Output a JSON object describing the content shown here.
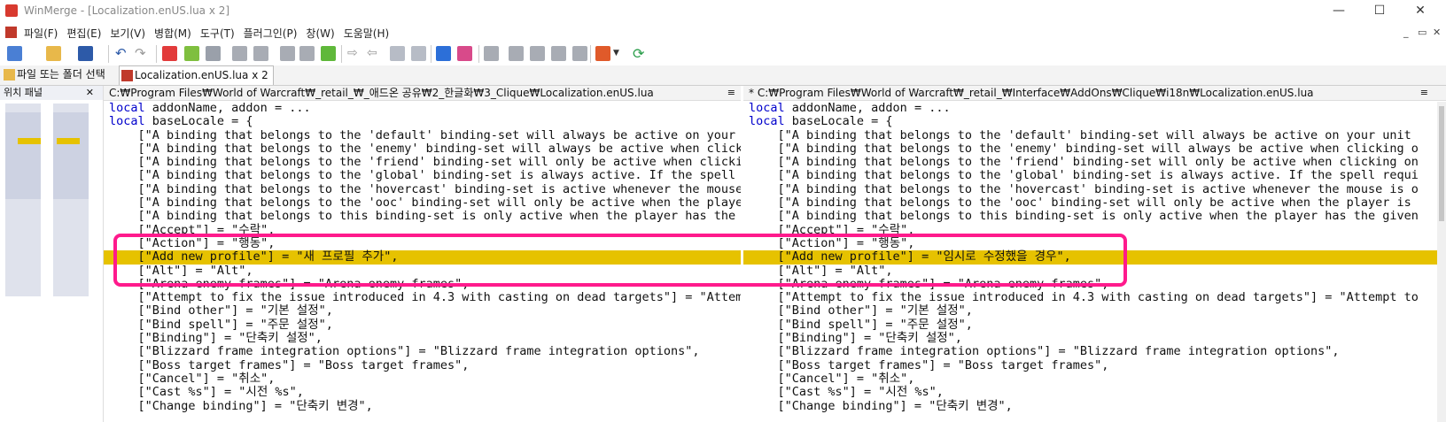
{
  "window": {
    "title": "WinMerge - [Localization.enUS.lua x 2]",
    "controls": [
      "—",
      "☐",
      "✕"
    ]
  },
  "menu": [
    "파일(F)",
    "편집(E)",
    "보기(V)",
    "병합(M)",
    "도구(T)",
    "플러그인(P)",
    "창(W)",
    "도움말(H)"
  ],
  "mdi_controls": [
    "_",
    "▭",
    "✕"
  ],
  "tabs": [
    {
      "label": "파일 또는 폴더 선택",
      "active": false
    },
    {
      "label": "Localization.enUS.lua x 2",
      "active": true
    }
  ],
  "location_pane": {
    "title": "위치 패널",
    "close": "✕"
  },
  "left_pane": {
    "path": "C:₩Program Files₩World of Warcraft₩_retail_₩_애드온 공유₩2_한글화₩3_Clique₩Localization.enUS.lua",
    "menu_glyph": "≡"
  },
  "right_pane": {
    "path": "* C:₩Program Files₩World of Warcraft₩_retail_₩Interface₩AddOns₩Clique₩i18n₩Localization.enUS.lua",
    "menu_glyph": "≡"
  },
  "left_lines": [
    {
      "kw": "local",
      "rest": " addonName, addon = ..."
    },
    {
      "kw": "local",
      "rest": " baseLocale = {"
    },
    {
      "kw": "",
      "rest": "    [\"A binding that belongs to the 'default' binding-set will always be active on your unit"
    },
    {
      "kw": "",
      "rest": "    [\"A binding that belongs to the 'enemy' binding-set will always be active when clicking o"
    },
    {
      "kw": "",
      "rest": "    [\"A binding that belongs to the 'friend' binding-set will only be active when clicking on"
    },
    {
      "kw": "",
      "rest": "    [\"A binding that belongs to the 'global' binding-set is always active. If the spell requi"
    },
    {
      "kw": "",
      "rest": "    [\"A binding that belongs to the 'hovercast' binding-set is active whenever the mouse is o"
    },
    {
      "kw": "",
      "rest": "    [\"A binding that belongs to the 'ooc' binding-set will only be active when the player is"
    },
    {
      "kw": "",
      "rest": "    [\"A binding that belongs to this binding-set is only active when the player has the given"
    },
    {
      "kw": "",
      "rest": "    [\"Accept\"] = \"수락\","
    },
    {
      "kw": "",
      "rest": "    [\"Action\"] = \"행동\","
    },
    {
      "kw": "",
      "rest": "    [\"Add new profile\"] = \"새 프로필 추가\",",
      "hl": true
    },
    {
      "kw": "",
      "rest": "    [\"Alt\"] = \"Alt\","
    },
    {
      "kw": "",
      "rest": "    [\"Arena enemy frames\"] = \"Arena enemy frames\","
    },
    {
      "kw": "",
      "rest": "    [\"Attempt to fix the issue introduced in 4.3 with casting on dead targets\"] = \"Attempt to"
    },
    {
      "kw": "",
      "rest": "    [\"Bind other\"] = \"기본 설정\","
    },
    {
      "kw": "",
      "rest": "    [\"Bind spell\"] = \"주문 설정\","
    },
    {
      "kw": "",
      "rest": "    [\"Binding\"] = \"단축키 설정\","
    },
    {
      "kw": "",
      "rest": "    [\"Blizzard frame integration options\"] = \"Blizzard frame integration options\","
    },
    {
      "kw": "",
      "rest": "    [\"Boss target frames\"] = \"Boss target frames\","
    },
    {
      "kw": "",
      "rest": "    [\"Cancel\"] = \"취소\","
    },
    {
      "kw": "",
      "rest": "    [\"Cast %s\"] = \"시전 %s\","
    },
    {
      "kw": "",
      "rest": "    [\"Change binding\"] = \"단축키 변경\","
    }
  ],
  "right_lines": [
    {
      "kw": "local",
      "rest": " addonName, addon = ..."
    },
    {
      "kw": "local",
      "rest": " baseLocale = {"
    },
    {
      "kw": "",
      "rest": "    [\"A binding that belongs to the 'default' binding-set will always be active on your unit"
    },
    {
      "kw": "",
      "rest": "    [\"A binding that belongs to the 'enemy' binding-set will always be active when clicking o"
    },
    {
      "kw": "",
      "rest": "    [\"A binding that belongs to the 'friend' binding-set will only be active when clicking on"
    },
    {
      "kw": "",
      "rest": "    [\"A binding that belongs to the 'global' binding-set is always active. If the spell requi"
    },
    {
      "kw": "",
      "rest": "    [\"A binding that belongs to the 'hovercast' binding-set is active whenever the mouse is o"
    },
    {
      "kw": "",
      "rest": "    [\"A binding that belongs to the 'ooc' binding-set will only be active when the player is"
    },
    {
      "kw": "",
      "rest": "    [\"A binding that belongs to this binding-set is only active when the player has the given"
    },
    {
      "kw": "",
      "rest": "    [\"Accept\"] = \"수락\","
    },
    {
      "kw": "",
      "rest": "    [\"Action\"] = \"행동\","
    },
    {
      "kw": "",
      "rest": "    [\"Add new profile\"] = \"임시로 수정했을 경우\",",
      "hl": true
    },
    {
      "kw": "",
      "rest": "    [\"Alt\"] = \"Alt\","
    },
    {
      "kw": "",
      "rest": "    [\"Arena enemy frames\"] = \"Arena enemy frames\","
    },
    {
      "kw": "",
      "rest": "    [\"Attempt to fix the issue introduced in 4.3 with casting on dead targets\"] = \"Attempt to"
    },
    {
      "kw": "",
      "rest": "    [\"Bind other\"] = \"기본 설정\","
    },
    {
      "kw": "",
      "rest": "    [\"Bind spell\"] = \"주문 설정\","
    },
    {
      "kw": "",
      "rest": "    [\"Binding\"] = \"단축키 설정\","
    },
    {
      "kw": "",
      "rest": "    [\"Blizzard frame integration options\"] = \"Blizzard frame integration options\","
    },
    {
      "kw": "",
      "rest": "    [\"Boss target frames\"] = \"Boss target frames\","
    },
    {
      "kw": "",
      "rest": "    [\"Cancel\"] = \"취소\","
    },
    {
      "kw": "",
      "rest": "    [\"Cast %s\"] = \"시전 %s\","
    },
    {
      "kw": "",
      "rest": "    [\"Change binding\"] = \"단축키 변경\","
    }
  ],
  "toolbar_icons": [
    "new-icon",
    "open-icon",
    "save-icon",
    "undo-icon",
    "redo-icon",
    "merge-icon",
    "copy-right-icon",
    "copy-left-icon",
    "first-diff-icon",
    "prev-diff-icon",
    "next-diff-icon",
    "last-diff-icon",
    "current-diff-icon",
    "options-icon",
    "refresh-icon"
  ],
  "colors": {
    "diff_highlight": "#e6c200",
    "annotation": "#ff1a8c",
    "keyword": "#0000cc"
  }
}
